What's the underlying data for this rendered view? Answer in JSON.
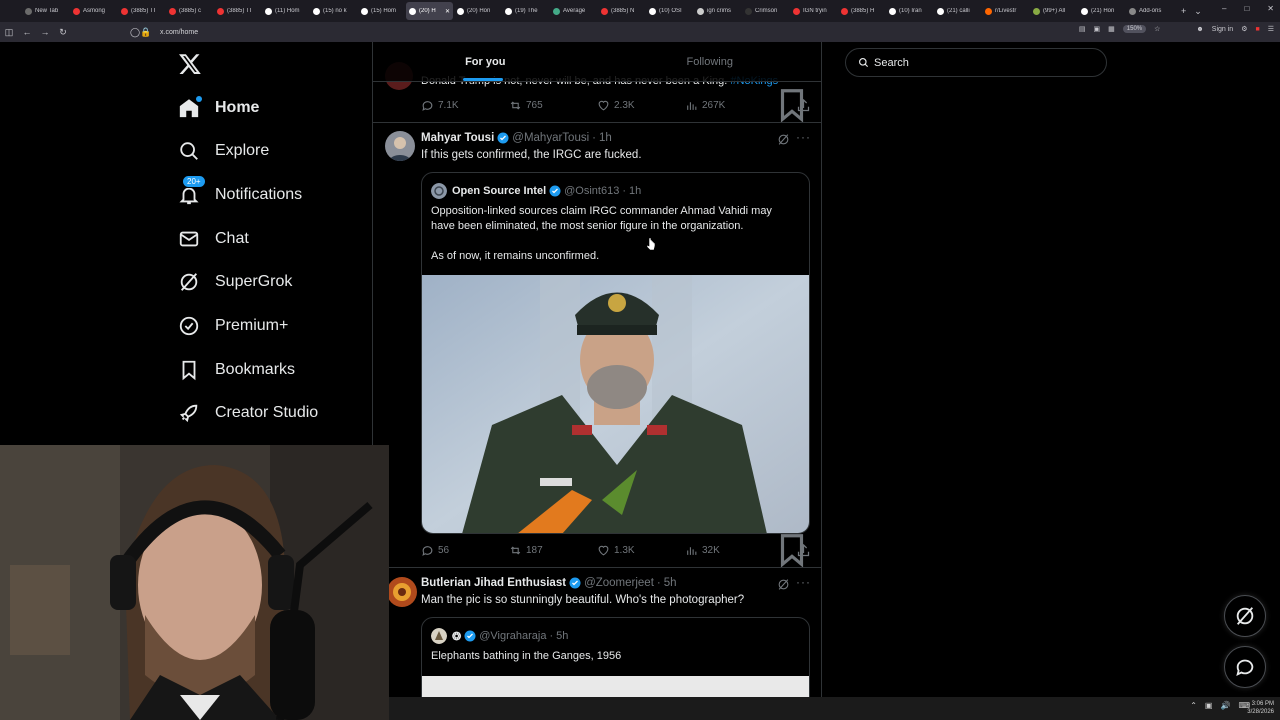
{
  "browser": {
    "tabs": [
      {
        "label": "New Tab",
        "color": "#6b6b6b"
      },
      {
        "label": "Asmong",
        "color": "#e33"
      },
      {
        "label": "(3885) TI",
        "color": "#e33"
      },
      {
        "label": "(3885) c",
        "color": "#e33"
      },
      {
        "label": "(3885) TI",
        "color": "#e33"
      },
      {
        "label": "(11) Hom",
        "color": "#fff"
      },
      {
        "label": "(15) no k",
        "color": "#fff"
      },
      {
        "label": "(15) Hom",
        "color": "#fff"
      },
      {
        "label": "(20) H",
        "color": "#fff",
        "active": true
      },
      {
        "label": "(20) Hon",
        "color": "#fff"
      },
      {
        "label": "(19) The",
        "color": "#fff"
      },
      {
        "label": "Average",
        "color": "#4a8"
      },
      {
        "label": "(3885) N",
        "color": "#e33"
      },
      {
        "label": "(10) OSI",
        "color": "#fff"
      },
      {
        "label": "ign crims",
        "color": "#ccc"
      },
      {
        "label": "Crimson",
        "color": "#333"
      },
      {
        "label": "IGN tryin",
        "color": "#e33"
      },
      {
        "label": "(3885) H",
        "color": "#e33"
      },
      {
        "label": "(10) Iran",
        "color": "#fff"
      },
      {
        "label": "(21) calli",
        "color": "#fff"
      },
      {
        "label": "r/Livestr",
        "color": "#f60"
      },
      {
        "label": "(99+) All",
        "color": "#8a4"
      },
      {
        "label": "(21) Hon",
        "color": "#fff"
      },
      {
        "label": "Add-ons",
        "color": "#888"
      }
    ],
    "url": "x.com/home",
    "zoom": "150%",
    "sign_in": "Sign in"
  },
  "nav": {
    "items": [
      {
        "label": "Home",
        "icon": "home-icon"
      },
      {
        "label": "Explore",
        "icon": "search-icon"
      },
      {
        "label": "Notifications",
        "icon": "bell-icon",
        "badge": "20+"
      },
      {
        "label": "Chat",
        "icon": "mail-icon"
      },
      {
        "label": "SuperGrok",
        "icon": "grok-icon"
      },
      {
        "label": "Premium+",
        "icon": "verified-icon"
      },
      {
        "label": "Bookmarks",
        "icon": "bookmark-icon"
      },
      {
        "label": "Creator Studio",
        "icon": "rocket-icon"
      }
    ]
  },
  "timeline": {
    "tabs": [
      "For you",
      "Following"
    ],
    "prev_post": {
      "text": "Donald Trump is not, never will be, and has never been a King.",
      "hashtag": "#NoKings",
      "replies": "7.1K",
      "reposts": "765",
      "likes": "2.3K",
      "views": "267K"
    },
    "posts": [
      {
        "name": "Mahyar Tousi",
        "handle": "@MahyarTousi",
        "time": "1h",
        "text": "If this gets confirmed, the IRGC are fucked.",
        "quote": {
          "name": "Open Source Intel",
          "handle": "@Osint613",
          "time": "1h",
          "line1": "Opposition-linked sources claim IRGC commander Ahmad Vahidi may",
          "line2": "have been eliminated, the most senior figure in the organization.",
          "line3": "As of now, it remains unconfirmed."
        },
        "replies": "56",
        "reposts": "187",
        "likes": "1.3K",
        "views": "32K"
      },
      {
        "name": "Butlerian Jihad Enthusiast",
        "handle": "@Zoomerjeet",
        "time": "5h",
        "text": "Man the pic is so stunningly beautiful. Who's the photographer?",
        "quote": {
          "name": "❂",
          "handle": "@Vigraharaja",
          "time": "5h",
          "line1": "Elephants bathing in the Ganges, 1956"
        }
      }
    ]
  },
  "search": {
    "placeholder": "Search"
  },
  "taskbar": {
    "time": "3:06 PM",
    "date": "3/28/2026"
  },
  "colors": {
    "accent": "#1d9bf0",
    "background": "#000000",
    "text": "#e7e9ea",
    "muted": "#71767b"
  }
}
